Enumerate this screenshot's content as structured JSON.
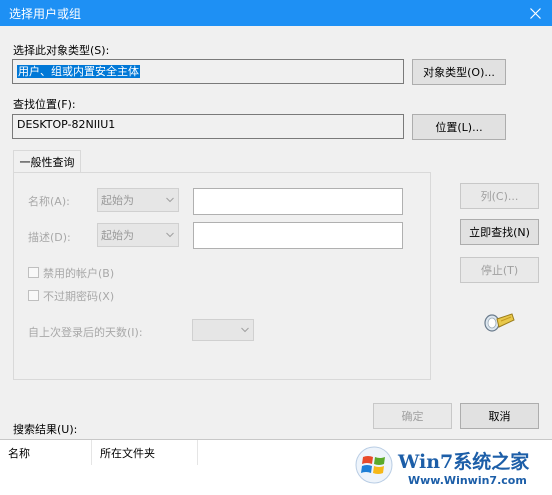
{
  "window": {
    "title": "选择用户或组"
  },
  "object_type": {
    "label": "选择此对象类型(S):",
    "value": "用户、组或内置安全主体",
    "button": "对象类型(O)..."
  },
  "location": {
    "label": "查找位置(F):",
    "value": "DESKTOP-82NIIU1",
    "button": "位置(L)..."
  },
  "tabs": [
    {
      "label": "一般性查询"
    }
  ],
  "query": {
    "name_label": "名称(A):",
    "name_mode": "起始为",
    "desc_label": "描述(D):",
    "desc_mode": "起始为",
    "disabled_accounts": "禁用的帐户(B)",
    "non_expiring": "不过期密码(X)",
    "days_label": "自上次登录后的天数(I):"
  },
  "side_buttons": {
    "columns": "列(C)...",
    "find_now": "立即查找(N)",
    "stop": "停止(T)"
  },
  "footer": {
    "ok": "确定",
    "cancel": "取消"
  },
  "results": {
    "label": "搜索结果(U):",
    "columns": [
      "名称",
      "所在文件夹"
    ]
  },
  "watermark": {
    "brand": "Win7系统之家",
    "url": "Www.Winwin7.com"
  },
  "colors": {
    "titlebar": "#1e90f4",
    "accent": "#0078d7"
  }
}
